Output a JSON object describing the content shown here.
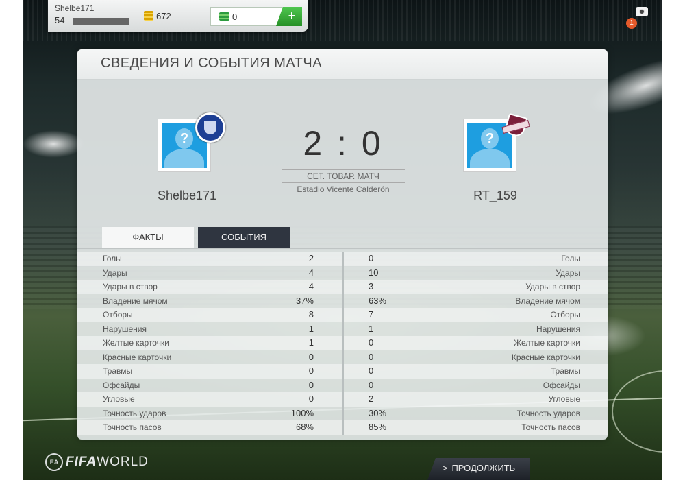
{
  "user": {
    "name": "Shelbe171",
    "level": "54",
    "xp_fraction": 1.0,
    "coins": "672",
    "points": "0",
    "add_points_label": "+"
  },
  "notifications": {
    "count": "1"
  },
  "panel": {
    "title": "СВЕДЕНИЯ И СОБЫТИЯ МАТЧА"
  },
  "match": {
    "home_name": "Shelbe171",
    "away_name": "RT_159",
    "score": "2 : 0",
    "type": "СЕТ. ТОВАР. МАТЧ",
    "stadium": "Estadio Vicente Calderón"
  },
  "tabs": {
    "facts": "ФАКТЫ",
    "events": "СОБЫТИЯ"
  },
  "stats": [
    {
      "label": "Голы",
      "home": "2",
      "away": "0"
    },
    {
      "label": "Удары",
      "home": "4",
      "away": "10"
    },
    {
      "label": "Удары в створ",
      "home": "4",
      "away": "3"
    },
    {
      "label": "Владение мячом",
      "home": "37%",
      "away": "63%"
    },
    {
      "label": "Отборы",
      "home": "8",
      "away": "7"
    },
    {
      "label": "Нарушения",
      "home": "1",
      "away": "1"
    },
    {
      "label": "Желтые карточки",
      "home": "1",
      "away": "0"
    },
    {
      "label": "Красные карточки",
      "home": "0",
      "away": "0"
    },
    {
      "label": "Травмы",
      "home": "0",
      "away": "0"
    },
    {
      "label": "Офсайды",
      "home": "0",
      "away": "0"
    },
    {
      "label": "Угловые",
      "home": "0",
      "away": "2"
    },
    {
      "label": "Точность ударов",
      "home": "100%",
      "away": "30%"
    },
    {
      "label": "Точность пасов",
      "home": "68%",
      "away": "85%"
    }
  ],
  "footer": {
    "logo_ea": "EA",
    "logo_fifa": "FIFA",
    "logo_world": "WORLD",
    "continue_label": "ПРОДОЛЖИТЬ"
  },
  "icons": {
    "coin": "coin-stack-icon",
    "points": "fifa-points-icon",
    "camera": "camera-icon",
    "chevron": "chevron-right-icon"
  },
  "colors": {
    "avatar_blue": "#1e9ee0",
    "add_button_green": "#279027",
    "events_tab_dark": "#2f3540",
    "notification_orange": "#e55a2b"
  }
}
